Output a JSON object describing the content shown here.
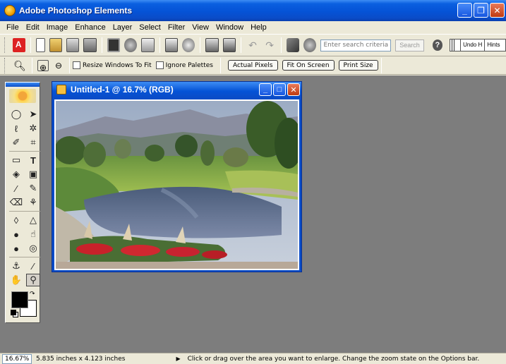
{
  "window": {
    "title": "Adobe Photoshop Elements",
    "controls": [
      "minimize",
      "restore",
      "close"
    ]
  },
  "menubar": {
    "items": [
      "File",
      "Edit",
      "Image",
      "Enhance",
      "Layer",
      "Select",
      "Filter",
      "View",
      "Window",
      "Help"
    ]
  },
  "shortcuts": {
    "icons": [
      "adobe-online-icon",
      "new-file-icon",
      "open-file-icon",
      "browse-icon",
      "import-icon",
      "save-icon",
      "save-for-web-icon",
      "attach-email-icon",
      "print-icon",
      "print-preview-icon",
      "online-services-icon",
      "web-photo-gallery-icon",
      "step-backward-icon",
      "step-forward-icon",
      "quick-fix-icon",
      "auto-levels-icon"
    ],
    "search_placeholder": "Enter search criteria",
    "search_button": "Search",
    "help_label": "?",
    "palette_well_tabs": [
      "Undo H",
      "Hints"
    ]
  },
  "options": {
    "resize_windows_label": "Resize Windows To Fit",
    "ignore_palettes_label": "Ignore Palettes",
    "actual_pixels": "Actual Pixels",
    "fit_on_screen": "Fit On Screen",
    "print_size": "Print Size"
  },
  "toolbox": {
    "tools": [
      "marquee",
      "move",
      "lasso",
      "magic-wand",
      "selection-brush",
      "crop",
      "custom-shape",
      "type",
      "paint-bucket",
      "gradient",
      "brush",
      "pencil",
      "eraser",
      "red-eye",
      "blur",
      "sharpen",
      "sponge",
      "smudge",
      "dodge",
      "burn",
      "clone-stamp",
      "eyedropper",
      "hand",
      "zoom"
    ],
    "active_tool": "zoom",
    "foreground_color": "#000000",
    "background_color": "#ffffff"
  },
  "document": {
    "title": "Untitled-1 @ 16.7% (RGB)"
  },
  "status": {
    "zoom": "16.67%",
    "doc_size": "5.835 inches x 4.123 inches",
    "message": "Click or drag over the area you want to enlarge. Change the zoom state on the Options bar."
  },
  "colors": {
    "title_bar": "#0553d6",
    "workspace": "#7d7d7d",
    "chrome": "#ece9d8"
  }
}
